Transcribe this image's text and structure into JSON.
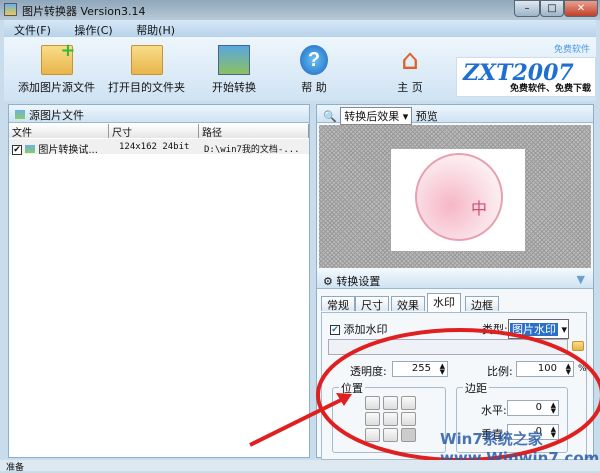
{
  "window": {
    "title": "图片转换器 Version3.14",
    "minimize": "–",
    "maximize": "□",
    "close": "✕"
  },
  "menu": [
    "文件(F)",
    "操作(C)",
    "帮助(H)"
  ],
  "toolbar": {
    "buttons": [
      "添加图片源文件",
      "打开目的文件夹",
      "开始转换",
      "帮 助",
      "主 页"
    ],
    "logo_text": "ZXT2007",
    "logo_sub": "免费软件、免费下载",
    "free_link": "免费软件"
  },
  "source_panel": {
    "title": "源图片文件",
    "columns": [
      "文件",
      "尺寸",
      "路径"
    ],
    "rows": [
      {
        "checked": true,
        "file": "图片转换试...",
        "size": "124x162  24bit",
        "path": "D:\\win7我的文档-..."
      }
    ]
  },
  "preview_panel": {
    "mode": "转换后效果",
    "label": "预览",
    "watermark_char": "中"
  },
  "settings": {
    "title": "转换设置",
    "tabs": [
      "常规",
      "尺寸",
      "效果",
      "水印",
      "边框"
    ],
    "active_tab": "水印",
    "add_watermark_label": "添加水印",
    "add_watermark": true,
    "type_label": "类型:",
    "type_value": "图片水印",
    "path_value": "",
    "opacity_label": "透明度:",
    "opacity": "255",
    "scale_label": "比例:",
    "scale": "100",
    "percent": "%",
    "position_label": "位置",
    "margin_label": "边距",
    "horizontal_label": "水平:",
    "horizontal": "0",
    "vertical_label": "垂直:",
    "vertical": "0"
  },
  "status": "准备",
  "watermark_overlay": "Win7系统之家 www.Winwin7.com"
}
